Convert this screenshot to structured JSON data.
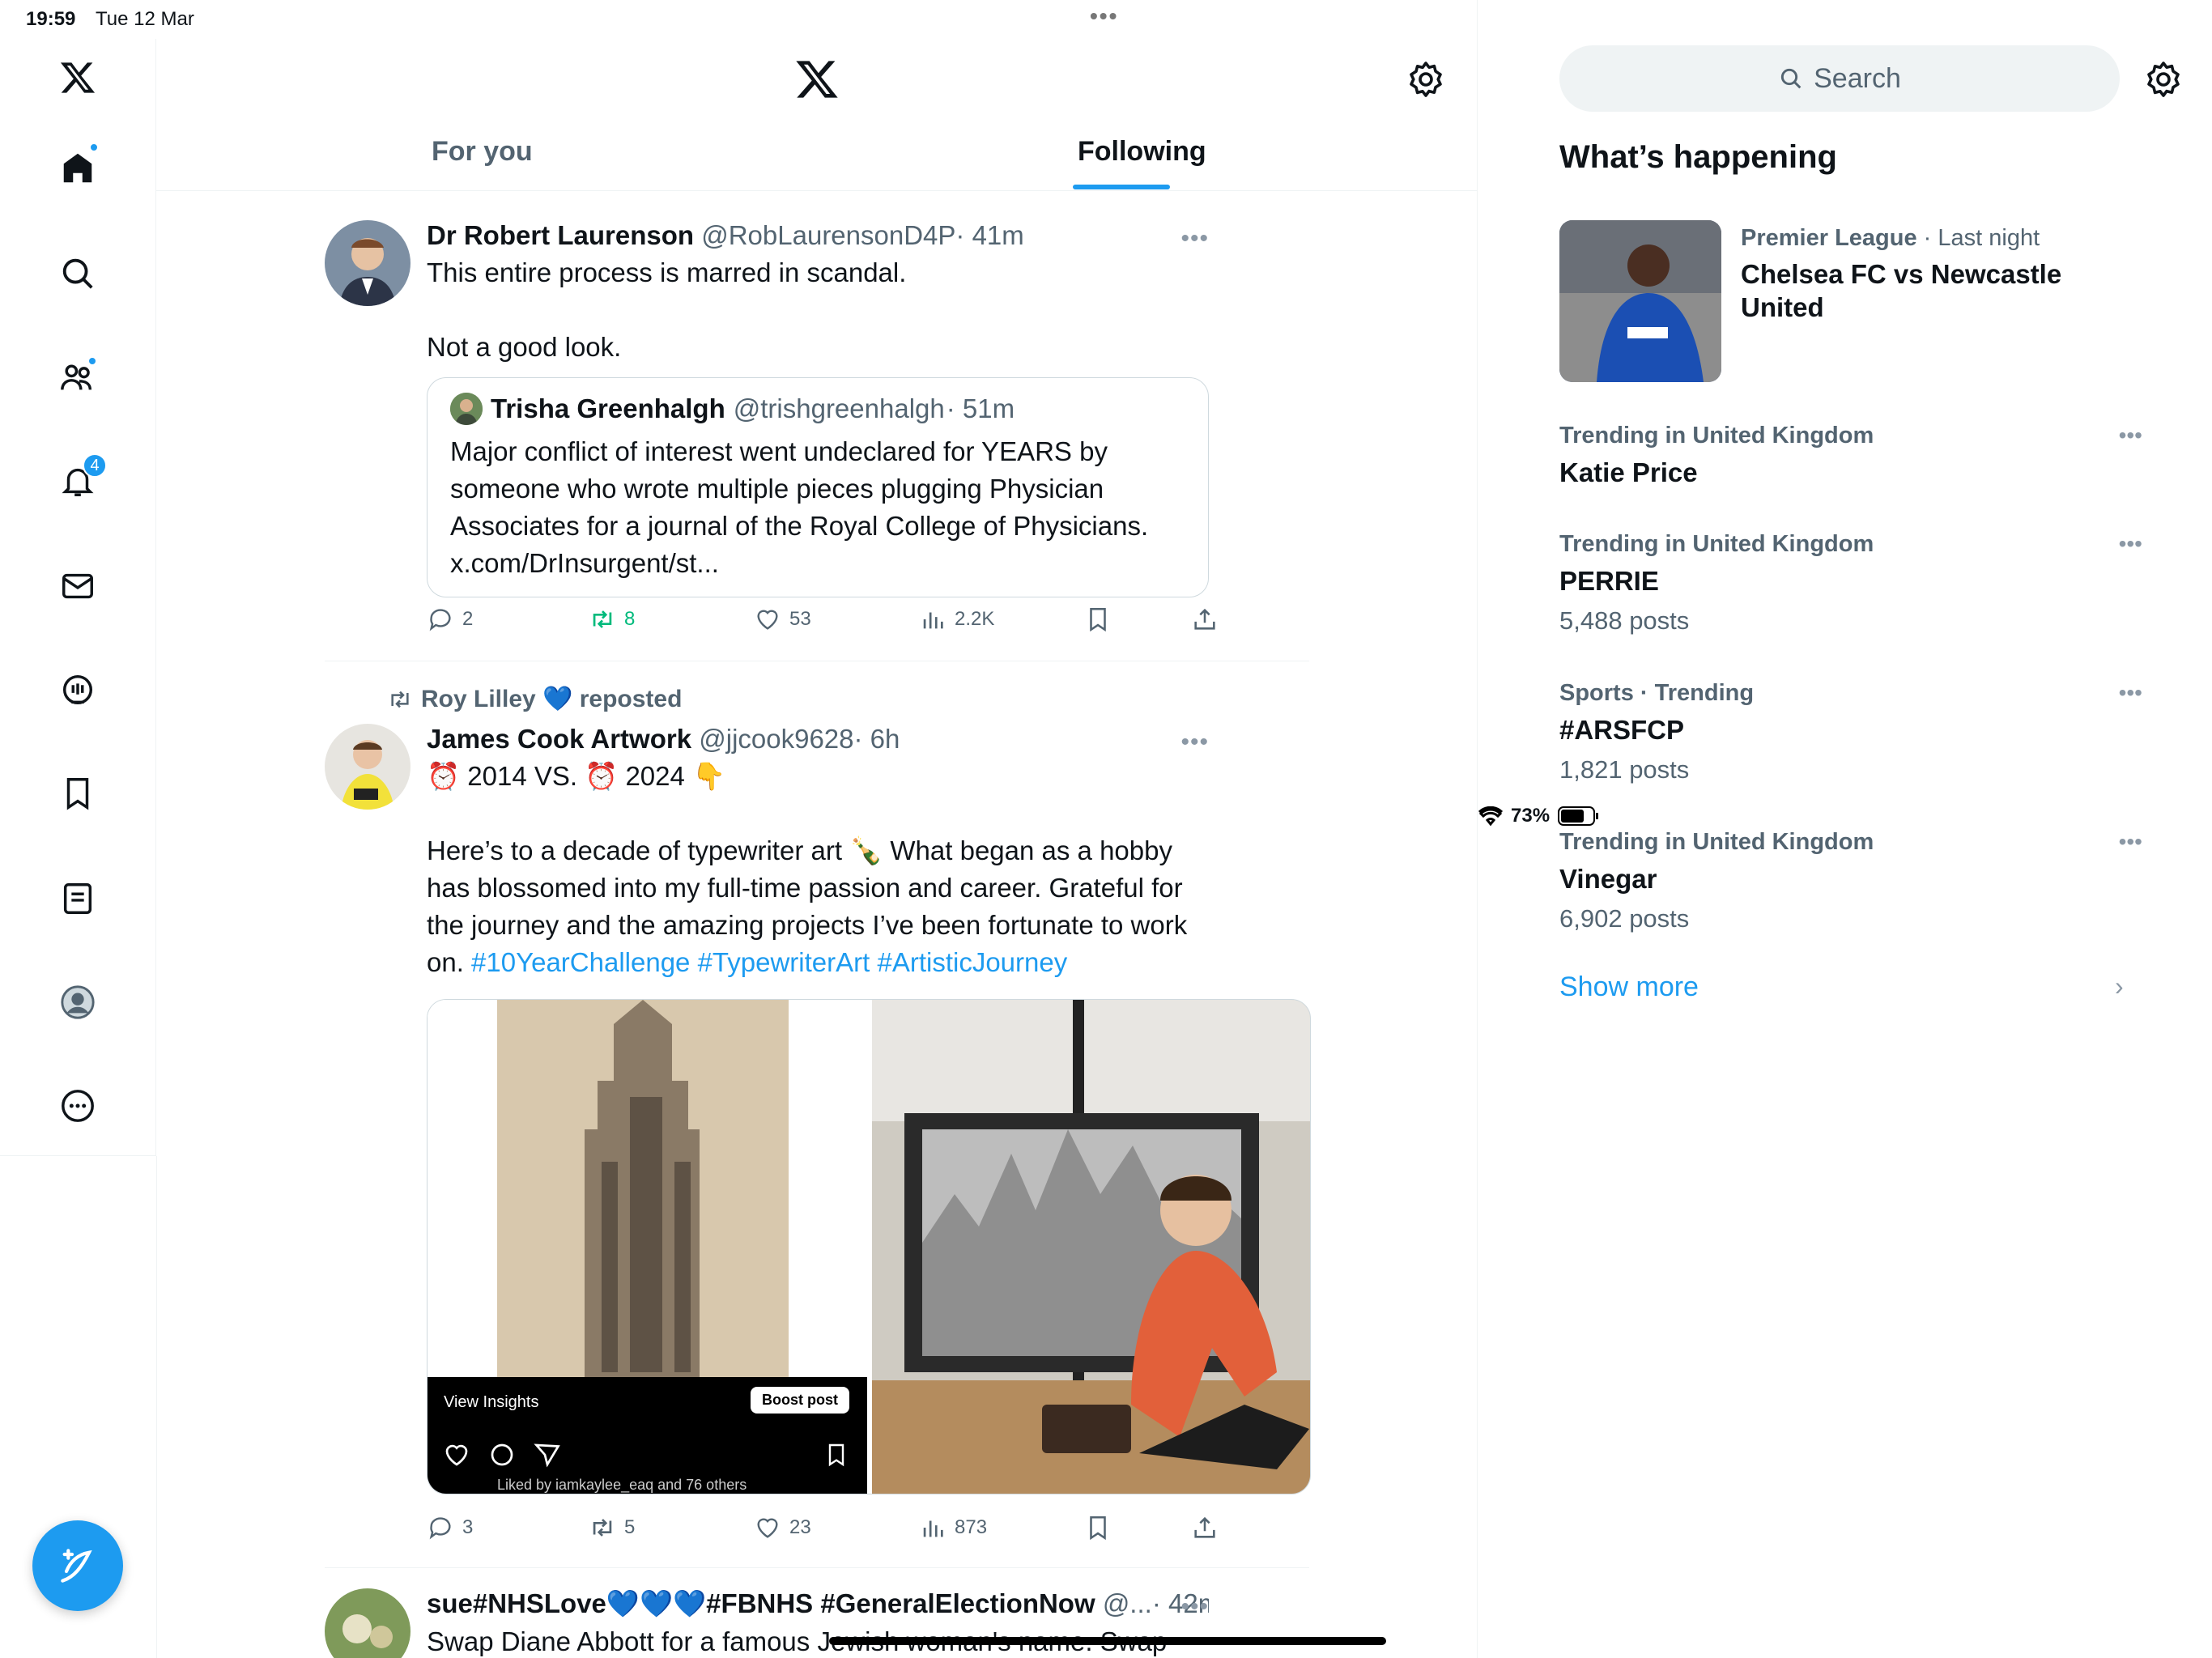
{
  "status_bar": {
    "time": "19:59",
    "date": "Tue 12 Mar",
    "battery": "73%",
    "battery_level": 0.73
  },
  "nav": {
    "notifications_badge": "4"
  },
  "header": {
    "tabs": [
      "For you",
      "Following"
    ],
    "active_tab": "Following"
  },
  "posts": [
    {
      "name": "Dr Robert Laurenson",
      "handle": "@RobLaurensonD4P",
      "time": "· 41m",
      "text": "This entire process is marred in scandal.\n\nNot a good look.",
      "quote": {
        "name": "Trisha Greenhalgh",
        "handle": "@trishgreenhalgh",
        "time": "· 51m",
        "text": "Major conflict of interest went undeclared for YEARS by someone who wrote multiple pieces plugging Physician Associates for a journal of the Royal College of Physicians. x.com/DrInsurgent/st..."
      },
      "replies": "2",
      "reposts": "8",
      "likes": "53",
      "views": "2.2K"
    },
    {
      "repost_by": "Roy Lilley 💙 reposted",
      "name": "James Cook Artwork",
      "handle": "@jjcook9628",
      "time": "· 6h",
      "line1": "⏰ 2014 VS. ⏰ 2024 👇",
      "text": "Here’s to a decade of typewriter art 🍾 What began as a hobby has blossomed into my full-time passion and career. Grateful for the journey and the amazing projects I’ve been fortunate to work on.",
      "hashtags": "#10YearChallenge #TypewriterArt #ArtisticJourney",
      "media": {
        "view_insights": "View Insights",
        "boost_post": "Boost post",
        "liked_by": "Liked by iamkaylee_eaq and 76 others"
      },
      "replies": "3",
      "reposts": "5",
      "likes": "23",
      "views": "873"
    },
    {
      "name": "sue#NHSLove💙💙💙#FBNHS #GeneralElectionNow",
      "handle": "@...",
      "time": "· 42m",
      "text": "Swap Diane Abbott for a famous Jewish woman's name. Swap 'Black'"
    }
  ],
  "sidebar": {
    "search_placeholder": "Search",
    "title": "What’s happening",
    "featured": {
      "category": "Premier League",
      "when": "· Last night",
      "title": "Chelsea FC vs Newcastle United"
    },
    "trends": [
      {
        "meta": "Trending in United Kingdom",
        "name": "Katie Price",
        "count": ""
      },
      {
        "meta": "Trending in United Kingdom",
        "name": "PERRIE",
        "count": "5,488 posts"
      },
      {
        "meta": "Sports · Trending",
        "name": "#ARSFCP",
        "count": "1,821 posts"
      },
      {
        "meta": "Trending in United Kingdom",
        "name": "Vinegar",
        "count": "6,902 posts"
      }
    ],
    "show_more": "Show more"
  },
  "colors": {
    "accent": "#1d9bf0",
    "repost_green": "#00ba7c",
    "muted": "#536471"
  }
}
